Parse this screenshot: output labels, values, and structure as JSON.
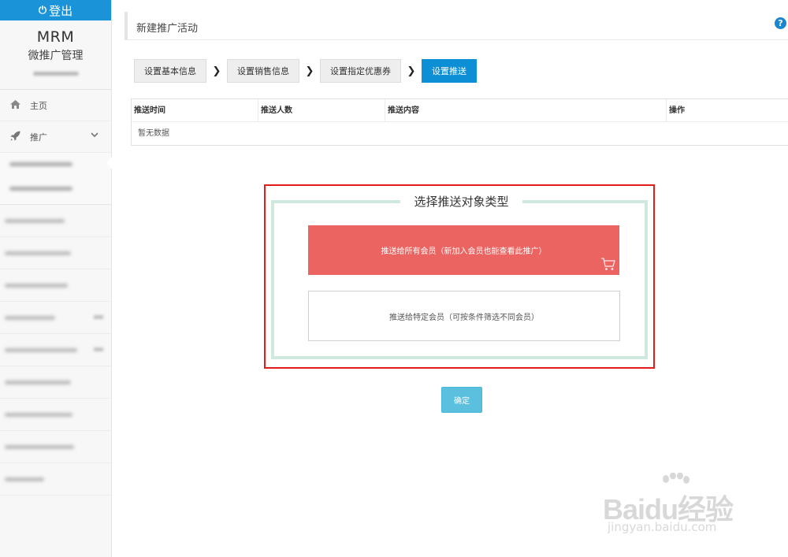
{
  "sidebar": {
    "logout_label": "登出",
    "brand_title": "MRM",
    "brand_subtitle": "微推广管理",
    "nav": [
      {
        "label": "主页",
        "icon": "home-icon"
      },
      {
        "label": "推广",
        "icon": "rocket-icon"
      }
    ]
  },
  "header": {
    "title": "新建推广活动"
  },
  "steps": [
    "设置基本信息",
    "设置销售信息",
    "设置指定优惠券",
    "设置推送"
  ],
  "active_step": 3,
  "table": {
    "columns": [
      "推送时间",
      "推送人数",
      "推送内容",
      "操作"
    ],
    "empty_text": "暂无数据"
  },
  "push_target": {
    "legend": "选择推送对象类型",
    "option_all": "推送给所有会员（新加入会员也能查看此推广）",
    "option_specific": "推送给特定会员（可按条件筛选不同会员）"
  },
  "confirm_label": "确定",
  "watermark": {
    "brand": "Baidu经验",
    "url": "jingyan.baidu.com"
  },
  "colors": {
    "primary": "#0d8fd5",
    "danger_option": "#eb6461",
    "confirm": "#5bc0de",
    "highlight_border": "#e31b1b",
    "fieldset_border": "#cfe9df"
  }
}
